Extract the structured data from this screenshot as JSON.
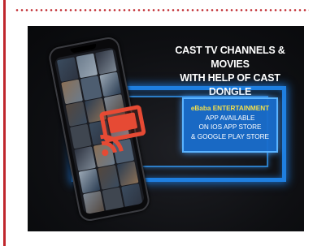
{
  "banner": {
    "headline_line1": "CAST TV CHANNELS & MOVIES",
    "headline_line2": "WITH HELP OF CAST DONGLE",
    "info_line1": "eBaba ENTERTAINMENT",
    "info_line2": "APP AVAILABLE",
    "info_line3": "ON IOS APP STORE",
    "info_line4": "& GOOGLE PLAY STORE"
  },
  "colors": {
    "accent_red": "#c0272d",
    "cast_icon_orange": "#e64a34",
    "frame_blue": "#1f7fe0",
    "info_box_blue": "#196ecd",
    "brand_yellow": "#f5e04a"
  },
  "icons": [
    "cast-icon"
  ]
}
